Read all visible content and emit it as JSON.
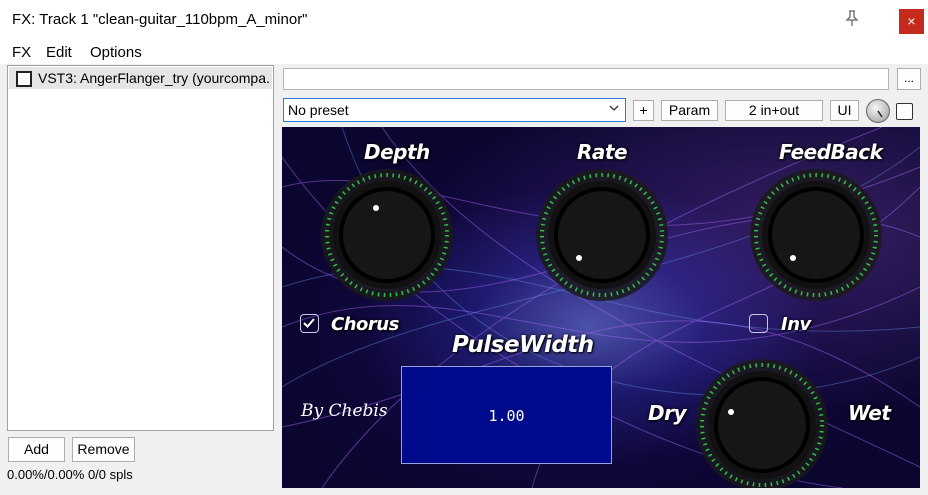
{
  "window": {
    "title": "FX: Track 1 \"clean-guitar_110bpm_A_minor\"",
    "close_label": "×"
  },
  "menu": {
    "items": [
      "FX",
      "Edit",
      "Options"
    ]
  },
  "fx_list": {
    "items": [
      {
        "label": "VST3: AngerFlanger_try (yourcompa...",
        "checked": false
      }
    ]
  },
  "buttons": {
    "add": "Add",
    "remove": "Remove",
    "more": "...",
    "plus": "+",
    "param": "Param",
    "io": "2 in+out",
    "ui": "UI"
  },
  "status": "0.00%/0.00% 0/0 spls",
  "preset": {
    "value": "No preset"
  },
  "plugin": {
    "labels": {
      "depth": "Depth",
      "rate": "Rate",
      "feedback": "FeedBack",
      "chorus": "Chorus",
      "inv": "Inv",
      "pulsewidth": "PulseWidth",
      "dry": "Dry",
      "wet": "Wet",
      "signature": "By Chebis"
    },
    "chorus_checked": true,
    "inv_checked": false,
    "pulsewidth_value": "1.00"
  },
  "icons": {
    "pin": "pin-icon",
    "check": "checkmark-icon",
    "dropdown": "chevron-down-icon"
  }
}
